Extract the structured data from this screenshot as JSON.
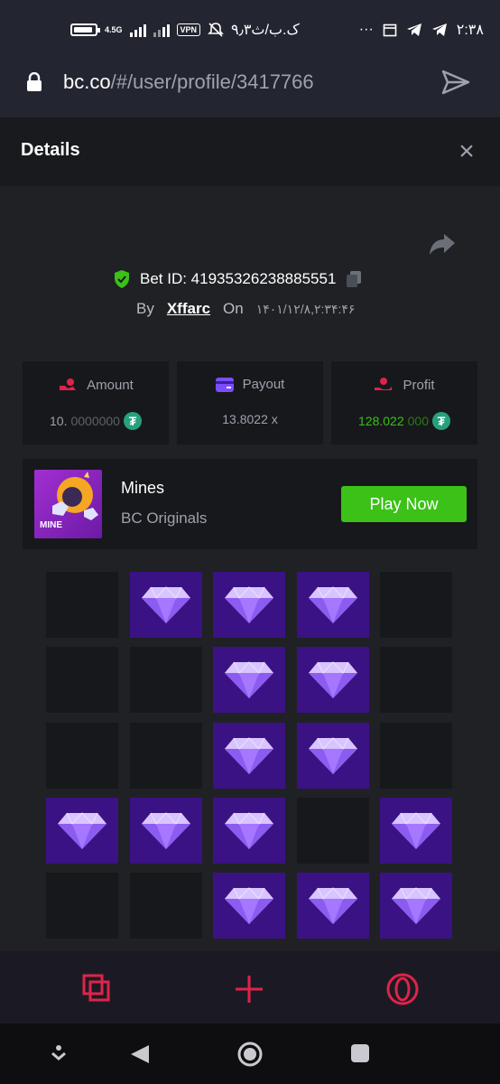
{
  "status_bar": {
    "network_type": "4.5G",
    "vpn_label": "VPN",
    "left_text": "۹٫۳ک.ب/ث",
    "time": "۲:۳۸",
    "overflow": "···"
  },
  "browser": {
    "url_host": "bc.co",
    "url_path": "/#/user/profile/3417766"
  },
  "header": {
    "title": "Details",
    "close_symbol": "×"
  },
  "bet": {
    "bet_id_label": "Bet ID: 41935326238885551",
    "by_label": "By",
    "username": "Xffarc",
    "on_label": "On",
    "date": "۱۴۰۱/۱۲/۸,۲:۳۴:۴۶"
  },
  "stats": {
    "amount": {
      "label": "Amount",
      "value_main": "10.",
      "value_dim": "0000000",
      "currency_icon": "tether-icon"
    },
    "payout": {
      "label": "Payout",
      "value": "13.8022 x"
    },
    "profit": {
      "label": "Profit",
      "value_main": "128.022",
      "value_dim": "000",
      "currency_icon": "tether-icon"
    }
  },
  "game": {
    "name": "Mines",
    "provider": "BC Originals",
    "thumb_label": "MINE",
    "play_label": "Play Now"
  },
  "mines_grid": {
    "rows": 5,
    "cols": 5,
    "cells": [
      [
        0,
        1,
        1,
        1,
        0
      ],
      [
        0,
        0,
        1,
        1,
        0
      ],
      [
        0,
        0,
        1,
        1,
        0
      ],
      [
        1,
        1,
        1,
        0,
        1
      ],
      [
        0,
        0,
        1,
        1,
        1
      ]
    ]
  },
  "bottom_bar": {
    "icons": [
      "tabs-icon",
      "plus-icon",
      "opera-icon"
    ]
  },
  "colors": {
    "accent_green": "#3bc117",
    "gem_bg": "#3b1283",
    "bottom_icon": "#e0234a"
  }
}
